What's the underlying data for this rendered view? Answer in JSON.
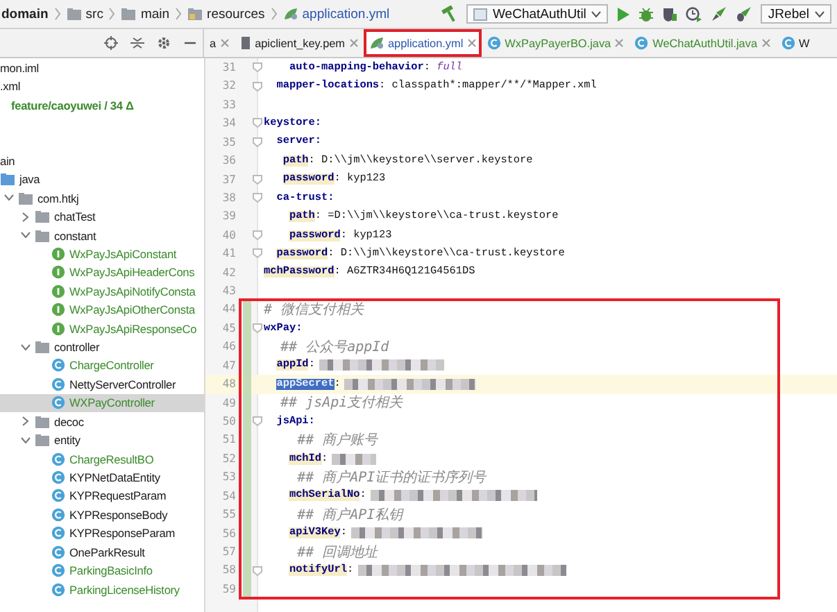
{
  "breadcrumb": [
    {
      "label": "domain",
      "kind": "module"
    },
    {
      "label": "src",
      "kind": "folder"
    },
    {
      "label": "main",
      "kind": "folder"
    },
    {
      "label": "resources",
      "kind": "resources"
    },
    {
      "label": "application.yml",
      "kind": "yaml"
    }
  ],
  "run_config": {
    "label": "WeChatAuthUtil"
  },
  "jrebel": {
    "label": "JRebel"
  },
  "tabs": [
    {
      "label": "a",
      "color": "#1a1a1a",
      "selected": false,
      "outlined": false
    },
    {
      "label": "apiclient_key.pem",
      "color": "#1a1a1a",
      "selected": false,
      "outlined": false,
      "kind": "file"
    },
    {
      "label": "application.yml",
      "color": "#2a55b0",
      "selected": true,
      "outlined": true,
      "kind": "yaml"
    },
    {
      "label": "WxPayPayerBO.java",
      "color": "#3a8a2a",
      "selected": false,
      "outlined": false,
      "kind": "class"
    },
    {
      "label": "WeChatAuthUtil.java",
      "color": "#3a8a2a",
      "selected": false,
      "outlined": false,
      "kind": "class"
    },
    {
      "label": "W",
      "color": "#1a1a1a",
      "selected": false,
      "outlined": false,
      "kind": "class"
    }
  ],
  "project_tree": {
    "top_rows": [
      {
        "label": "mon.iml",
        "kind": "file"
      },
      {
        "label": ".xml",
        "kind": "file"
      },
      {
        "label": "feature/caoyuwei / 34 Δ",
        "kind": "branch"
      }
    ],
    "nodes": [
      {
        "label": "ain",
        "color": "#1a1a1a",
        "selected": false,
        "children": [
          {
            "label": "java",
            "kind": "source",
            "color": "#1a1a1a",
            "selected": false,
            "children": [
              {
                "label": "com.htkj",
                "kind": "folder",
                "color": "#1a1a1a",
                "selected": false,
                "expanded": true,
                "children": [
                  {
                    "label": "chatTest",
                    "kind": "folder",
                    "color": "#1a1a1a",
                    "selected": false,
                    "expanded": false
                  },
                  {
                    "label": "constant",
                    "kind": "folder",
                    "color": "#1a1a1a",
                    "selected": false,
                    "expanded": true,
                    "children": [
                      {
                        "label": "WxPayJsApiConstant",
                        "kind": "interface",
                        "color": "#3a8a2a",
                        "selected": false
                      },
                      {
                        "label": "WxPayJsApiHeaderCons",
                        "kind": "interface",
                        "color": "#3a8a2a",
                        "selected": false
                      },
                      {
                        "label": "WxPayJsApiNotifyConsta",
                        "kind": "interface",
                        "color": "#3a8a2a",
                        "selected": false
                      },
                      {
                        "label": "WxPayJsApiOtherConsta",
                        "kind": "interface",
                        "color": "#3a8a2a",
                        "selected": false
                      },
                      {
                        "label": "WxPayJsApiResponseCo",
                        "kind": "interface",
                        "color": "#3a8a2a",
                        "selected": false
                      }
                    ]
                  },
                  {
                    "label": "controller",
                    "kind": "folder",
                    "color": "#1a1a1a",
                    "selected": false,
                    "expanded": true,
                    "children": [
                      {
                        "label": "ChargeController",
                        "kind": "class",
                        "color": "#3a8a2a",
                        "selected": false
                      },
                      {
                        "label": "NettyServerController",
                        "kind": "class",
                        "color": "#1a1a1a",
                        "selected": false
                      },
                      {
                        "label": "WXPayController",
                        "kind": "class",
                        "color": "#3a8a2a",
                        "selected": true
                      }
                    ]
                  },
                  {
                    "label": "decoc",
                    "kind": "folder",
                    "color": "#1a1a1a",
                    "selected": false,
                    "expanded": false
                  },
                  {
                    "label": "entity",
                    "kind": "folder",
                    "color": "#1a1a1a",
                    "selected": false,
                    "expanded": true,
                    "children": [
                      {
                        "label": "ChargeResultBO",
                        "kind": "class",
                        "color": "#3a8a2a",
                        "selected": false
                      },
                      {
                        "label": "KYPNetDataEntity",
                        "kind": "class",
                        "color": "#1a1a1a",
                        "selected": false
                      },
                      {
                        "label": "KYPRequestParam",
                        "kind": "class",
                        "color": "#1a1a1a",
                        "selected": false
                      },
                      {
                        "label": "KYPResponseBody",
                        "kind": "class",
                        "color": "#1a1a1a",
                        "selected": false
                      },
                      {
                        "label": "KYPResponseParam",
                        "kind": "class",
                        "color": "#1a1a1a",
                        "selected": false
                      },
                      {
                        "label": "OneParkResult",
                        "kind": "class",
                        "color": "#1a1a1a",
                        "selected": false
                      },
                      {
                        "label": "ParkingBasicInfo",
                        "kind": "class",
                        "color": "#3a8a2a",
                        "selected": false
                      },
                      {
                        "label": "ParkingLicenseHistory",
                        "kind": "class",
                        "color": "#3a8a2a",
                        "selected": false
                      }
                    ]
                  }
                ]
              }
            ]
          }
        ]
      }
    ]
  },
  "editor": {
    "blocks": [
      {
        "lines": [
          {
            "number": "31",
            "fold": true,
            "tokens": [
              {
                "kind": "key",
                "text": "    auto-mapping-behavior",
                "highlighted": false,
                "selected": false
              },
              {
                "kind": "plain",
                "text": ": "
              },
              {
                "kind": "constant",
                "text": "full"
              }
            ]
          },
          {
            "number": "32",
            "fold": true,
            "tokens": [
              {
                "kind": "key",
                "text": "  mapper-locations",
                "highlighted": false,
                "selected": false
              },
              {
                "kind": "plain",
                "text": ": classpath*:mapper/**/*Mapper.xml"
              }
            ]
          },
          {
            "number": "33"
          },
          {
            "number": "34",
            "fold": true,
            "tokens": [
              {
                "kind": "key",
                "text": "keystore:",
                "highlighted": false,
                "selected": false
              }
            ]
          },
          {
            "number": "35",
            "fold": true,
            "tokens": [
              {
                "kind": "key",
                "text": "  server:",
                "highlighted": false,
                "selected": false
              }
            ]
          },
          {
            "number": "36",
            "tokens": [
              {
                "kind": "key",
                "text": "   path",
                "highlighted": true,
                "selected": false
              },
              {
                "kind": "plain",
                "text": ": D:\\\\jm\\\\keystore\\\\server.keystore"
              }
            ]
          },
          {
            "number": "37",
            "fold": true,
            "tokens": [
              {
                "kind": "key",
                "text": "   password",
                "highlighted": true,
                "selected": false
              },
              {
                "kind": "plain",
                "text": ": kyp123"
              }
            ]
          },
          {
            "number": "38",
            "fold": true,
            "tokens": [
              {
                "kind": "key",
                "text": "  ca-trust:",
                "highlighted": false,
                "selected": false
              }
            ]
          },
          {
            "number": "39",
            "tokens": [
              {
                "kind": "key",
                "text": "    path",
                "highlighted": true,
                "selected": false
              },
              {
                "kind": "plain",
                "text": ": =D:\\\\jm\\\\keystore\\\\ca-trust.keystore"
              }
            ]
          },
          {
            "number": "40",
            "fold": true,
            "tokens": [
              {
                "kind": "key",
                "text": "    password",
                "highlighted": true,
                "selected": false
              },
              {
                "kind": "plain",
                "text": ": kyp123"
              }
            ]
          },
          {
            "number": "41",
            "fold": true,
            "tokens": [
              {
                "kind": "key",
                "text": "  password",
                "highlighted": true,
                "selected": false
              },
              {
                "kind": "plain",
                "text": ": D:\\\\jm\\\\keystore\\\\ca-trust.keystore"
              }
            ]
          },
          {
            "number": "42",
            "tokens": [
              {
                "kind": "key",
                "text": "mchPassword",
                "highlighted": true,
                "selected": false
              },
              {
                "kind": "plain",
                "text": ": A6ZTR34H6Q121G4561DS"
              }
            ]
          },
          {
            "number": "43"
          }
        ]
      },
      {
        "boxed": true,
        "changed": true,
        "lines": [
          {
            "number": "44",
            "tokens": [
              {
                "kind": "comment",
                "text": "# 微信支付相关"
              }
            ]
          },
          {
            "number": "45",
            "fold": true,
            "tokens": [
              {
                "kind": "key",
                "text": "wxPay:",
                "highlighted": false,
                "selected": false
              }
            ]
          },
          {
            "number": "46",
            "tokens": [
              {
                "kind": "comment",
                "text": "  ## 公众号appId"
              }
            ]
          },
          {
            "number": "47",
            "tokens": [
              {
                "kind": "key",
                "text": "  appId",
                "highlighted": true,
                "selected": false
              },
              {
                "kind": "plain",
                "text": ":"
              },
              {
                "kind": "redacted"
              }
            ]
          },
          {
            "number": "48",
            "current": true,
            "tokens": [
              {
                "kind": "key",
                "text": "  appSecret",
                "selected": true
              },
              {
                "kind": "plain",
                "text": ":"
              },
              {
                "kind": "redacted"
              }
            ]
          },
          {
            "number": "49",
            "tokens": [
              {
                "kind": "comment",
                "text": "  ## jsApi支付相关"
              }
            ]
          },
          {
            "number": "50",
            "fold": true,
            "tokens": [
              {
                "kind": "key",
                "text": "  jsApi:",
                "highlighted": false,
                "selected": false
              }
            ]
          },
          {
            "number": "51",
            "tokens": [
              {
                "kind": "comment",
                "text": "    ## 商户账号"
              }
            ]
          },
          {
            "number": "52",
            "tokens": [
              {
                "kind": "key",
                "text": "    mchId",
                "highlighted": true,
                "selected": false
              },
              {
                "kind": "plain",
                "text": ":"
              },
              {
                "kind": "redacted"
              }
            ]
          },
          {
            "number": "53",
            "tokens": [
              {
                "kind": "comment",
                "text": "    ## 商户API证书的证书序列号"
              }
            ]
          },
          {
            "number": "54",
            "tokens": [
              {
                "kind": "key",
                "text": "    mchSerialNo",
                "highlighted": true,
                "selected": false
              },
              {
                "kind": "plain",
                "text": ":"
              },
              {
                "kind": "redacted"
              }
            ]
          },
          {
            "number": "55",
            "tokens": [
              {
                "kind": "comment",
                "text": "    ## 商户API私钥"
              }
            ]
          },
          {
            "number": "56",
            "tokens": [
              {
                "kind": "key",
                "text": "    apiV3Key",
                "highlighted": true,
                "selected": false
              },
              {
                "kind": "plain",
                "text": ":"
              },
              {
                "kind": "redacted"
              }
            ]
          },
          {
            "number": "57",
            "tokens": [
              {
                "kind": "comment",
                "text": "    ## 回调地址"
              }
            ]
          },
          {
            "number": "58",
            "fold": true,
            "tokens": [
              {
                "kind": "key",
                "text": "    notifyUrl",
                "highlighted": true,
                "selected": false
              },
              {
                "kind": "plain",
                "text": ":"
              },
              {
                "kind": "redacted"
              }
            ]
          },
          {
            "number": "59"
          }
        ]
      }
    ]
  }
}
